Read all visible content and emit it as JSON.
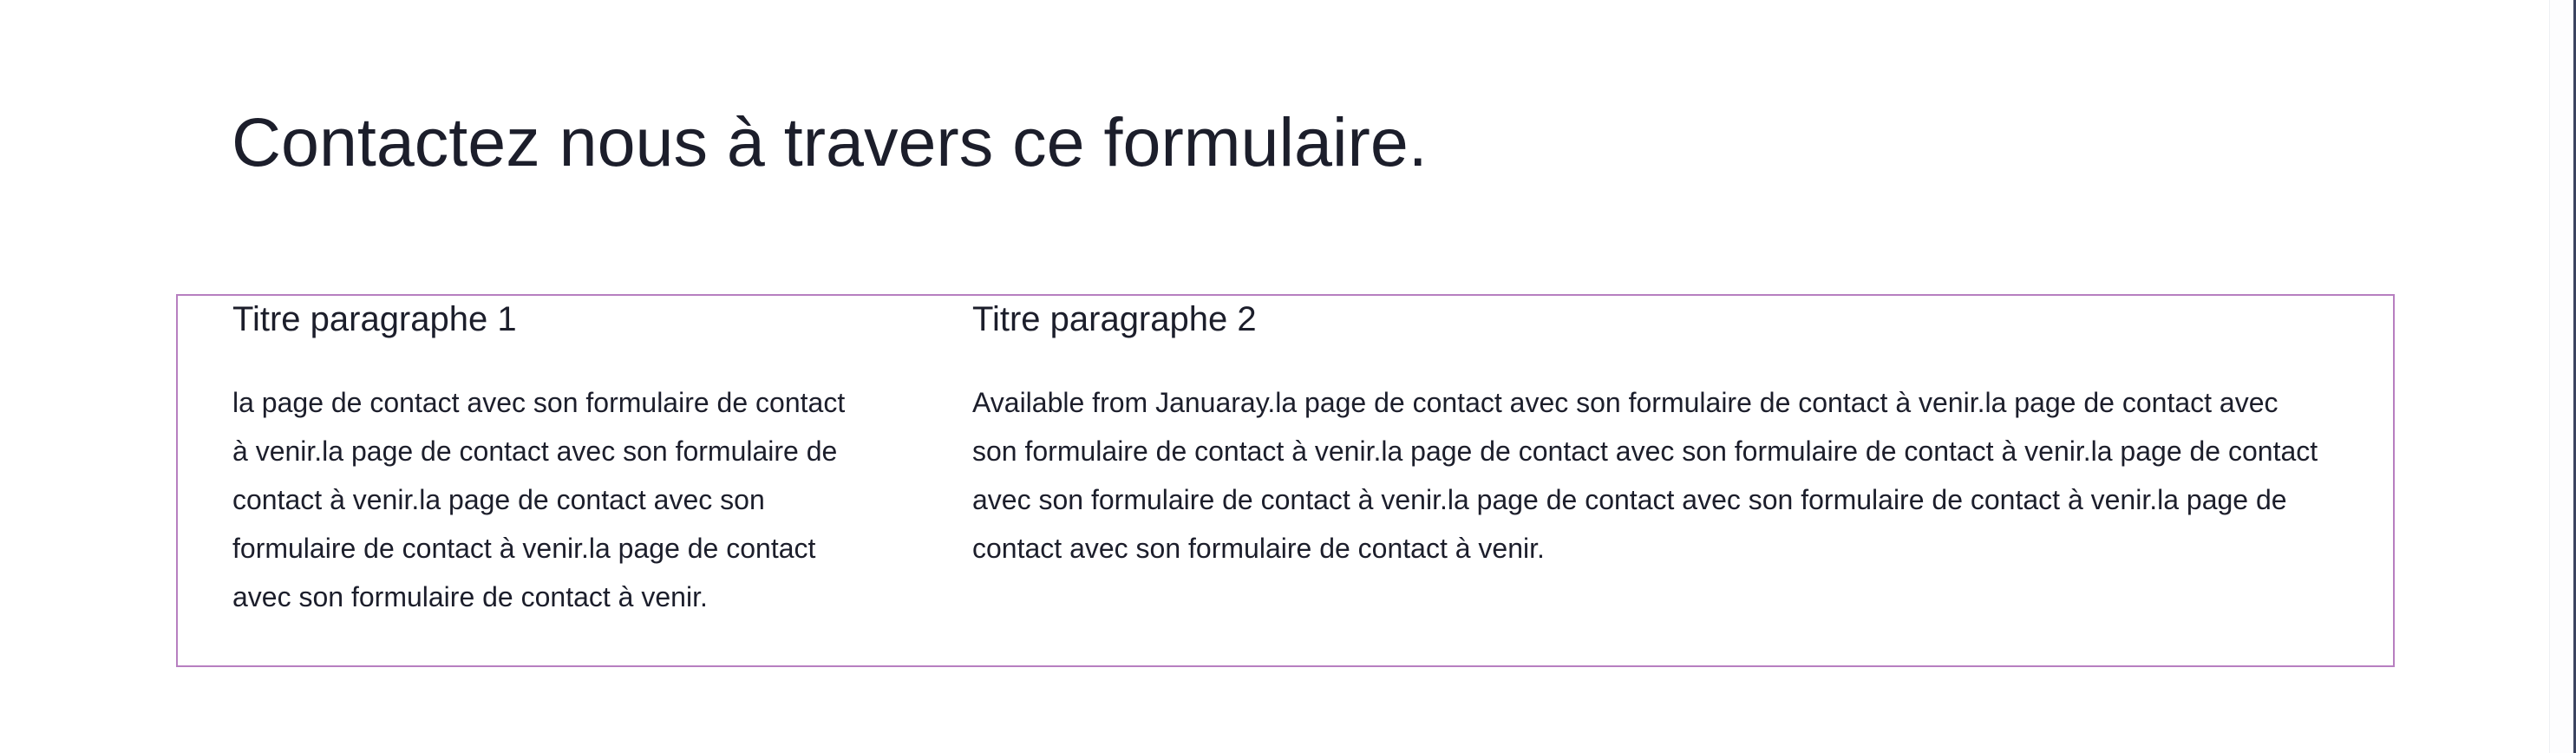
{
  "page": {
    "title": "Contactez nous à travers ce formulaire."
  },
  "columns": [
    {
      "title": "Titre paragraphe 1",
      "text": "la page de contact avec son formulaire de contact à venir.la page de contact avec son formulaire de contact à venir.la page de contact avec son formulaire de contact à venir.la page de contact avec son formulaire de contact à venir."
    },
    {
      "title": "Titre paragraphe 2",
      "text": "Available from Januaray.la page de contact avec son formulaire de contact à venir.la page de contact avec son formulaire de contact à venir.la page de contact avec son formulaire de contact à venir.la page de contact avec son formulaire de contact à venir.la page de contact avec son formulaire de contact à venir.la page de contact avec son formulaire de contact à venir."
    }
  ],
  "colors": {
    "text": "#1c1e2b",
    "box_border": "#b77fc0",
    "background": "#ffffff",
    "scrollbar": "#3b4360"
  }
}
